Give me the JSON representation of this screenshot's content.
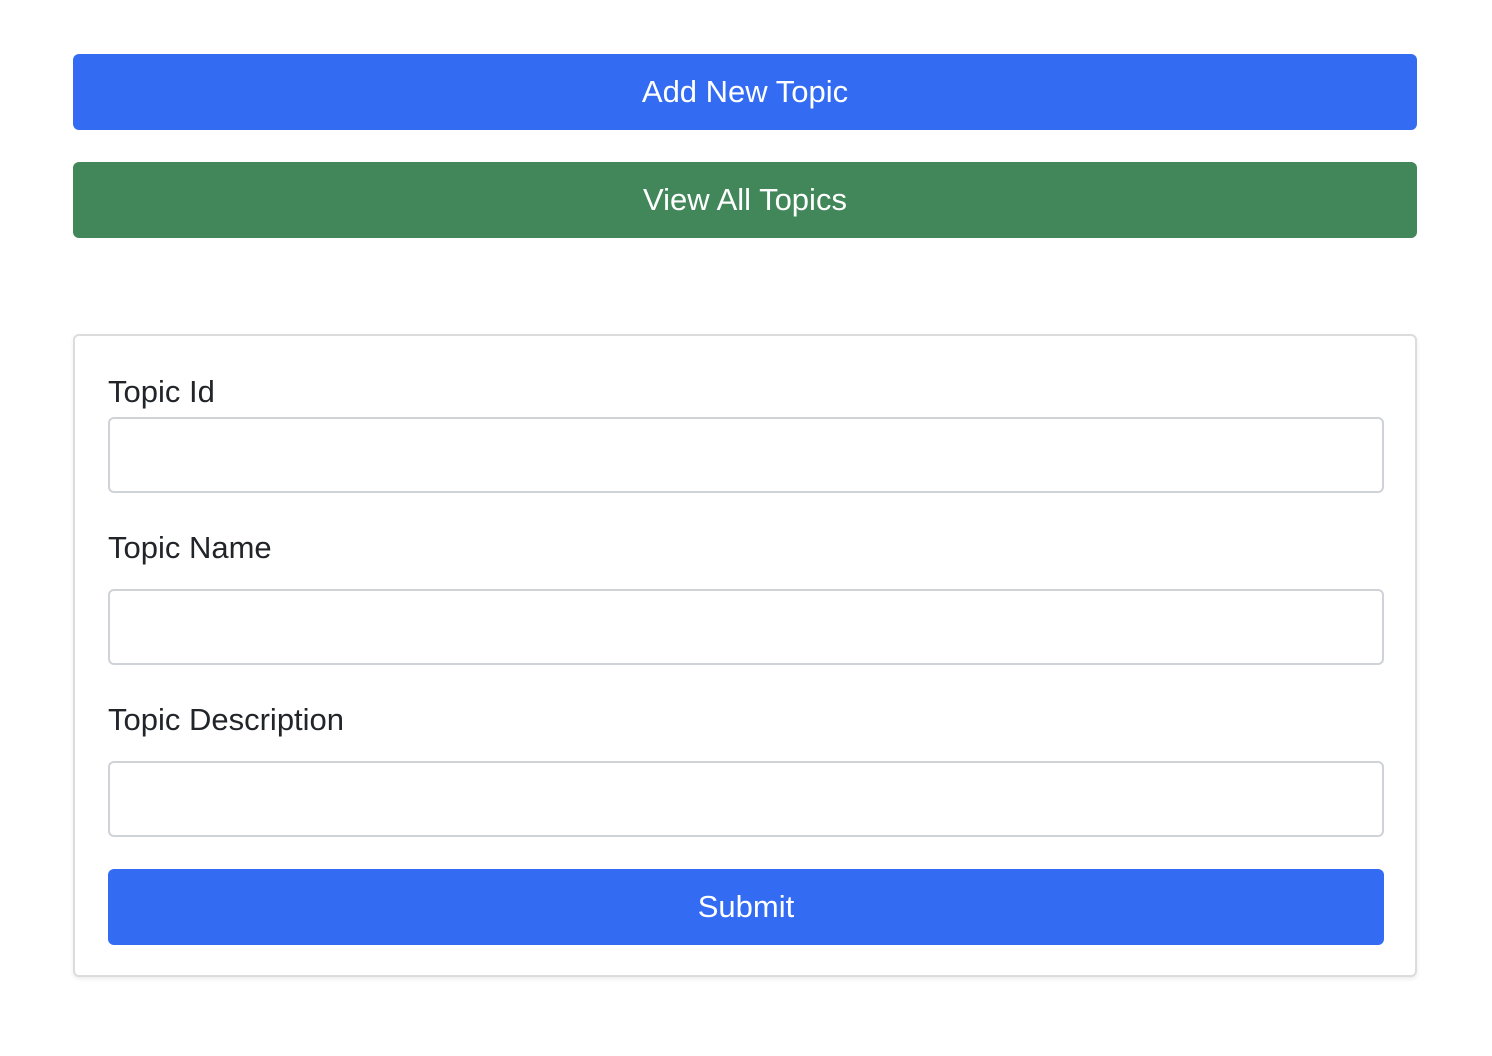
{
  "nav": {
    "add_label": "Add New Topic",
    "view_label": "View All Topics"
  },
  "form": {
    "topic_id_label": "Topic Id",
    "topic_id_value": "",
    "topic_name_label": "Topic Name",
    "topic_name_value": "",
    "topic_description_label": "Topic Description",
    "topic_description_value": "",
    "submit_label": "Submit"
  },
  "colors": {
    "primary": "#336cf3",
    "success": "#41875a"
  }
}
